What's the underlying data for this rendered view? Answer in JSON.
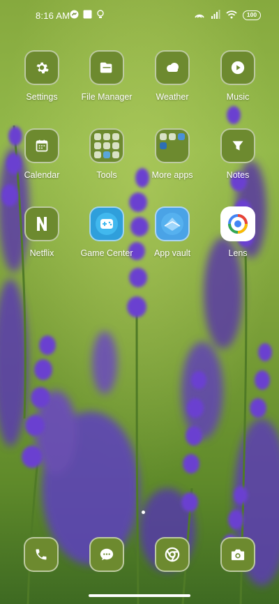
{
  "status_bar": {
    "time": "8:16 AM",
    "battery": "100"
  },
  "apps": [
    {
      "label": "Settings",
      "icon": "gear-icon"
    },
    {
      "label": "File Manager",
      "icon": "folder-icon"
    },
    {
      "label": "Weather",
      "icon": "cloud-icon"
    },
    {
      "label": "Music",
      "icon": "play-icon"
    },
    {
      "label": "Calendar",
      "icon": "calendar-icon"
    },
    {
      "label": "Tools",
      "icon": "folder-grid-icon"
    },
    {
      "label": "More apps",
      "icon": "folder-grid-icon"
    },
    {
      "label": "Notes",
      "icon": "notes-icon"
    },
    {
      "label": "Netflix",
      "icon": "netflix-icon"
    },
    {
      "label": "Game Center",
      "icon": "gamepad-icon"
    },
    {
      "label": "App vault",
      "icon": "vault-icon"
    },
    {
      "label": "Lens",
      "icon": "lens-icon"
    }
  ],
  "dock": [
    {
      "icon": "phone-icon"
    },
    {
      "icon": "message-icon"
    },
    {
      "icon": "chrome-icon"
    },
    {
      "icon": "camera-icon"
    }
  ],
  "colors": {
    "tile": "#6d8a2f",
    "wallpaper_green": "#7ea23a",
    "lavender": "#6a3fc9"
  }
}
